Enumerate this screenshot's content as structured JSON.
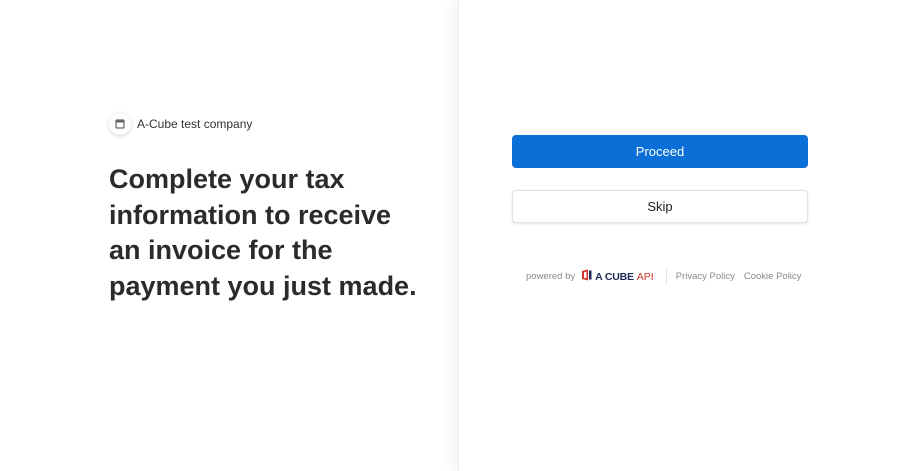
{
  "company": {
    "name": "A-Cube test company",
    "icon": "store-icon"
  },
  "headline": "Complete your tax information to receive an invoice for the payment you just made.",
  "actions": {
    "proceed_label": "Proceed",
    "skip_label": "Skip"
  },
  "footer": {
    "powered_by": "powered by",
    "brand_name": "A CUBE",
    "brand_suffix": "API",
    "links": [
      "Privacy Policy",
      "Cookie Policy"
    ]
  },
  "colors": {
    "primary": "#0a6fd6",
    "brand_dark": "#1f2a56",
    "brand_red": "#d6322c"
  }
}
